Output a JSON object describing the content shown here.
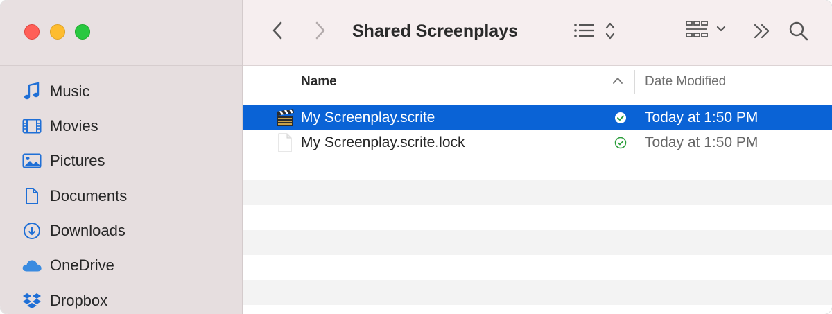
{
  "window": {
    "title": "Shared Screenplays"
  },
  "sidebar": {
    "items": [
      {
        "label": "Music",
        "icon": "music-note-icon"
      },
      {
        "label": "Movies",
        "icon": "film-strip-icon"
      },
      {
        "label": "Pictures",
        "icon": "photo-icon"
      },
      {
        "label": "Documents",
        "icon": "document-icon"
      },
      {
        "label": "Downloads",
        "icon": "download-circle-icon"
      },
      {
        "label": "OneDrive",
        "icon": "onedrive-cloud-icon"
      },
      {
        "label": "Dropbox",
        "icon": "dropbox-icon"
      }
    ]
  },
  "toolbar": {
    "back_icon": "chevron-left-icon",
    "forward_icon": "chevron-right-icon",
    "list_view_icon": "list-view-icon",
    "group_icon": "grid-group-icon",
    "more_icon": "double-chevron-right-icon",
    "search_icon": "search-icon"
  },
  "columns": {
    "name": "Name",
    "date_modified": "Date Modified"
  },
  "files": [
    {
      "name": "My Screenplay.scrite",
      "date": "Today at 1:50 PM",
      "icon": "clapperboard-icon",
      "status": "synced-icon",
      "selected": true
    },
    {
      "name": "My Screenplay.scrite.lock",
      "date": "Today at 1:50 PM",
      "icon": "blank-document-icon",
      "status": "synced-icon",
      "selected": false
    }
  ],
  "colors": {
    "accent": "#0a63d6",
    "sidebar_bg": "#e6dedf",
    "toolbar_bg": "#f6eeef",
    "icon_blue": "#1f6fd6",
    "sync_green": "#2a9d3a"
  }
}
